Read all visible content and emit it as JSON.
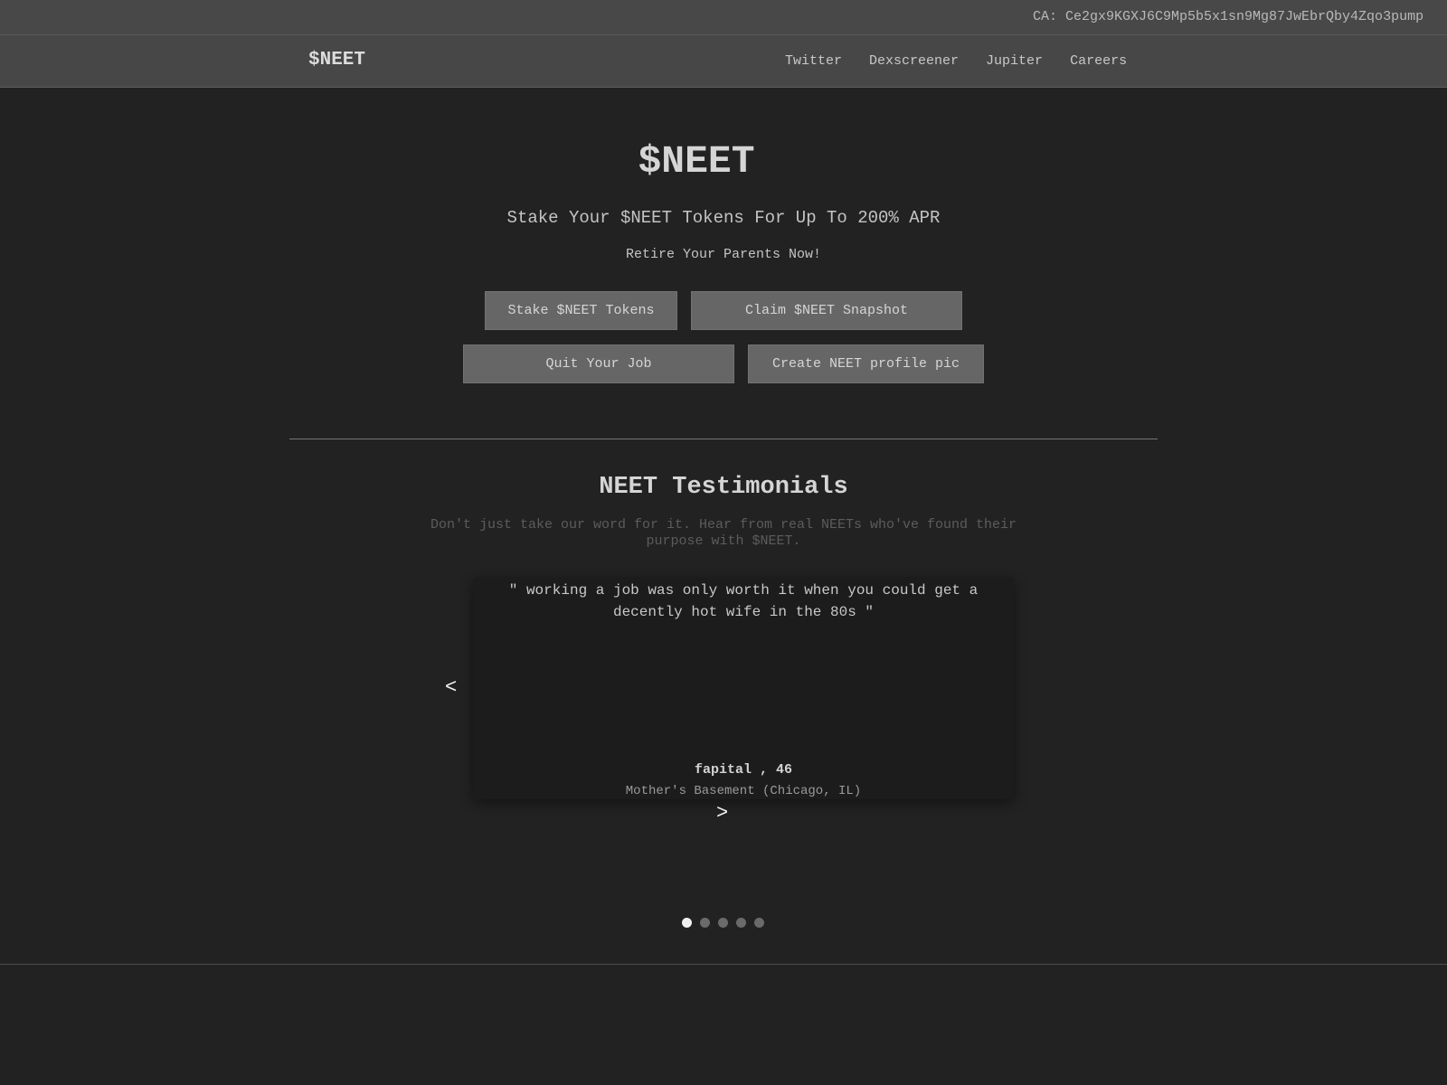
{
  "contract": {
    "text": "CA: Ce2gx9KGXJ6C9Mp5b5x1sn9Mg87JwEbrQby4Zqo3pump"
  },
  "nav": {
    "logo": "$NEET",
    "links": [
      "Twitter",
      "Dexscreener",
      "Jupiter",
      "Careers"
    ]
  },
  "hero": {
    "title": "$NEET",
    "subtitle": "Stake Your $NEET Tokens For Up To 200% APR",
    "tagline": "Retire Your Parents Now!",
    "buttons": {
      "stake": "Stake $NEET Tokens",
      "claim": "Claim $NEET Snapshot",
      "quit": "Quit Your Job",
      "profile": "Create NEET profile pic"
    }
  },
  "testimonials": {
    "title": "NEET Testimonials",
    "subtitle": "Don't just take our word for it. Hear from real NEETs who've found their purpose with $NEET.",
    "current": {
      "quote": "\" working a job was only worth it when you could get a decently hot wife in the 80s \"",
      "author": "fapital , 46",
      "location": "Mother's Basement (Chicago, IL)"
    },
    "prev_label": "<",
    "next_label": ">",
    "dot_count": 5,
    "active_index": 0
  },
  "colors": {
    "background": "#222222",
    "topbar": "#484848",
    "button": "#666666",
    "card": "#1c1c1c"
  }
}
